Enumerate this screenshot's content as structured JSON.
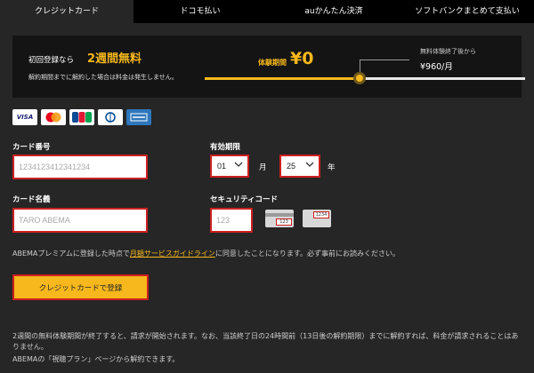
{
  "tabs": [
    "クレジットカード",
    "ドコモ払い",
    "auかんたん決済",
    "ソフトバンクまとめて支払い"
  ],
  "banner": {
    "line1_prefix": "初回登録なら",
    "line1_highlight": "2週間無料",
    "line2": "解約期間までに解約した場合は料金は発生しません。",
    "trial_label": "体験期間",
    "trial_price": "¥0",
    "after_label": "無料体験終了後から",
    "after_price": "¥960/月",
    "colors": {
      "accent": "#f6b81c",
      "background": "#141414"
    }
  },
  "card_logos": [
    "VISA",
    "Mastercard",
    "JCB",
    "Diners Club",
    "American Express"
  ],
  "form": {
    "card_number_label": "カード番号",
    "card_number_placeholder": "1234123412341234",
    "expiry_label": "有効期限",
    "expiry_month": "01",
    "expiry_month_unit": "月",
    "expiry_year": "25",
    "expiry_year_unit": "年",
    "card_name_label": "カード名義",
    "card_name_placeholder": "TARO ABEMA",
    "security_code_label": "セキュリティコード",
    "security_code_placeholder": "123",
    "cvv_sample_1": "123",
    "cvv_sample_2": "1234"
  },
  "agreement": {
    "prefix": "ABEMAプレミアムに登録した時点で",
    "link": "月額サービスガイドライン",
    "suffix": "に同意したことになります。必ず事前にお読みください。"
  },
  "submit_label": "クレジットカードで登録",
  "notes": [
    "2週間の無料体験期間が終了すると、請求が開始されます。なお、当該終了日の24時間前（13日後の解約期限）までに解約すれば、料金が請求されることはありません。",
    "ABEMAの「視聴プラン」ページから解約できます。"
  ],
  "colors": {
    "page_bg": "#262626",
    "tab_bg": "#000000",
    "accent": "#f6b81c",
    "error_border": "#cc2020"
  }
}
